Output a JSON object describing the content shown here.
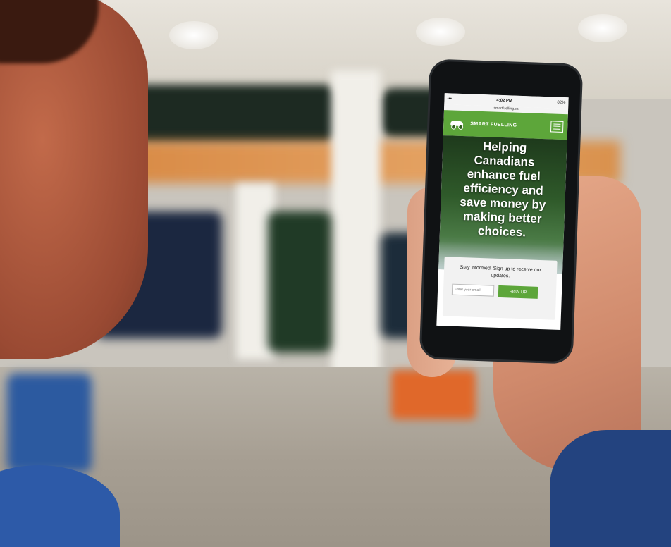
{
  "phone": {
    "status_bar": {
      "time": "4:02 PM",
      "battery": "82%",
      "url": "smartfuelling.ca"
    },
    "nav": {
      "brand": "SMART FUELLING",
      "logo_icon": "car-icon",
      "menu_icon": "hamburger-menu-icon"
    },
    "hero": {
      "headline": "Helping Canadians enhance fuel efficiency and save money by making better choices."
    },
    "signup": {
      "text": "Stay informed. Sign up to receive our updates.",
      "email_placeholder": "Enter your email",
      "button_label": "SIGN UP"
    }
  },
  "colors": {
    "brand_green": "#5da63a",
    "sleeve_blue": "#23437f"
  }
}
